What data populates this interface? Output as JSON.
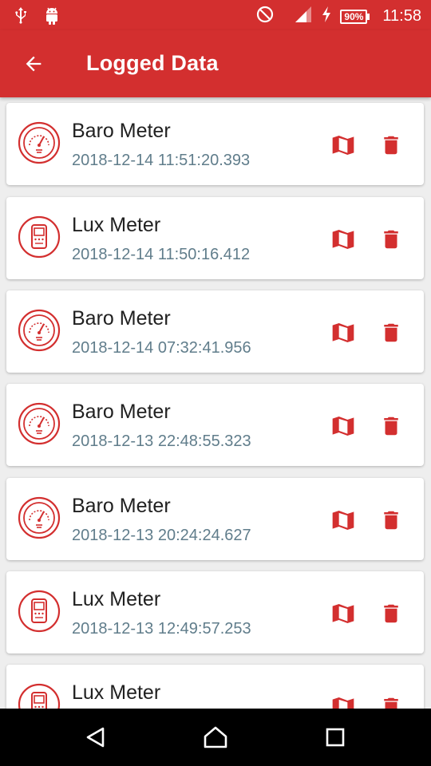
{
  "status_bar": {
    "time": "11:58",
    "battery": "90%",
    "icons": [
      "usb-icon",
      "android-icon",
      "do-not-disturb-icon",
      "signal-icon",
      "charging-icon",
      "battery-icon"
    ]
  },
  "app_bar": {
    "title": "Logged Data",
    "back_icon": "arrow-back-icon"
  },
  "accent_color": "#d32f2f",
  "timestamp_color": "#607d8b",
  "items": [
    {
      "name": "Baro Meter",
      "timestamp": "2018-12-14 11:51:20.393",
      "icon": "barometer-icon"
    },
    {
      "name": "Lux Meter",
      "timestamp": "2018-12-14 11:50:16.412",
      "icon": "lux-meter-icon"
    },
    {
      "name": "Baro Meter",
      "timestamp": "2018-12-14 07:32:41.956",
      "icon": "barometer-icon"
    },
    {
      "name": "Baro Meter",
      "timestamp": "2018-12-13 22:48:55.323",
      "icon": "barometer-icon"
    },
    {
      "name": "Baro Meter",
      "timestamp": "2018-12-13 20:24:24.627",
      "icon": "barometer-icon"
    },
    {
      "name": "Lux Meter",
      "timestamp": "2018-12-13 12:49:57.253",
      "icon": "lux-meter-icon"
    },
    {
      "name": "Lux Meter",
      "timestamp": "",
      "icon": "lux-meter-icon"
    }
  ],
  "row_actions": [
    "map-icon",
    "delete-icon"
  ],
  "nav_bar": [
    "back-triangle-icon",
    "home-circle-icon",
    "recents-square-icon"
  ]
}
